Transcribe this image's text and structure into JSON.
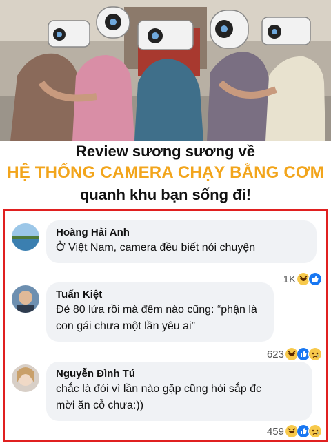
{
  "caption": {
    "line1": "Review sương sương về",
    "line2": "HỆ THỐNG CAMERA CHẠY BẰNG CƠM",
    "line3": "quanh khu bạn sống đi!"
  },
  "comments": [
    {
      "name": "Hoàng Hải Anh",
      "lines": [
        "Ở Việt Nam, camera đều biết nói chuyện"
      ],
      "reaction_count": "1K",
      "reactions": [
        "haha-icon",
        "like-icon"
      ]
    },
    {
      "name": "Tuấn Kiệt",
      "lines": [
        "Đẻ 80 lứa rồi mà đêm nào cũng: “phận là",
        "con gái chưa một lần yêu ai”"
      ],
      "reaction_count": "623",
      "reactions": [
        "haha-icon",
        "like-icon",
        "sad-icon"
      ]
    },
    {
      "name": "Nguyễn Đình Tú",
      "lines": [
        "chắc là đói vì lần nào gặp cũng hỏi sắp đc",
        "mời ăn cỗ chưa:))"
      ],
      "reaction_count": "459",
      "reactions": [
        "haha-icon",
        "like-icon",
        "sad-icon"
      ]
    }
  ],
  "colors": {
    "highlight": "#f2a51c",
    "border": "#e02020",
    "bubble": "#f0f2f5",
    "like": "#1877f2",
    "haha": "#f7c94b"
  }
}
